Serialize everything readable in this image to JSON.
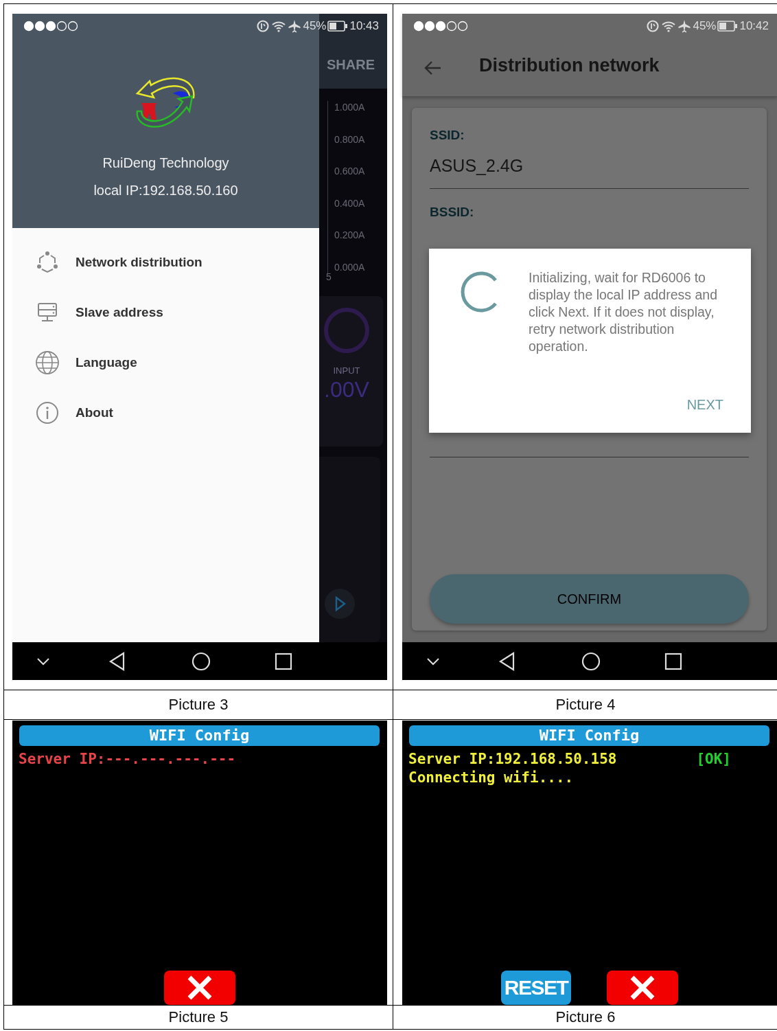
{
  "cells": [
    {
      "kind": "drawer_screen",
      "caption": "Picture 3",
      "status_bar": {
        "battery": "45%",
        "time": "10:43"
      },
      "background_app": {
        "action": "SHARE",
        "axis_labels": [
          "1.000A",
          "0.800A",
          "0.600A",
          "0.400A",
          "0.200A",
          "0.000A"
        ],
        "x_label": "5",
        "gauge_label": "INPUT",
        "gauge_value": ".00V"
      },
      "drawer": {
        "company": "RuiDeng Technology",
        "local_ip": "local IP:192.168.50.160",
        "items": [
          {
            "kind": "network",
            "label": "Network distribution"
          },
          {
            "kind": "slave",
            "label": "Slave address"
          },
          {
            "kind": "language",
            "label": "Language"
          },
          {
            "kind": "about",
            "label": "About"
          }
        ]
      }
    },
    {
      "kind": "dialog_screen",
      "caption": "Picture 4",
      "status_bar": {
        "battery": "45%",
        "time": "10:42"
      },
      "title": "Distribution network",
      "fields": [
        {
          "label": "SSID:",
          "value": "ASUS_2.4G"
        },
        {
          "label": "BSSID:"
        }
      ],
      "dialog": {
        "message": "Initializing, wait for RD6006 to display the local IP address and click Next. If it does not display, retry network distribution operation.",
        "action": "NEXT"
      },
      "confirm": "CONFIRM"
    },
    {
      "kind": "device_screen",
      "caption": "Picture 5",
      "title": "WIFI Config",
      "lines": [
        {
          "text": "Server IP:---.---.---.---",
          "color": "#e8434a"
        }
      ],
      "buttons": [
        {
          "kind": "close"
        }
      ]
    },
    {
      "kind": "device_screen",
      "caption": "Picture 6",
      "title": "WIFI Config",
      "lines": [
        {
          "text": "Server IP:192.168.50.158",
          "color": "#f0f03c",
          "status": "[OK]"
        },
        {
          "text": "Connecting wifi....",
          "color": "#f0f03c"
        }
      ],
      "buttons": [
        {
          "kind": "reset",
          "label": "RESET"
        },
        {
          "kind": "close"
        }
      ]
    }
  ]
}
